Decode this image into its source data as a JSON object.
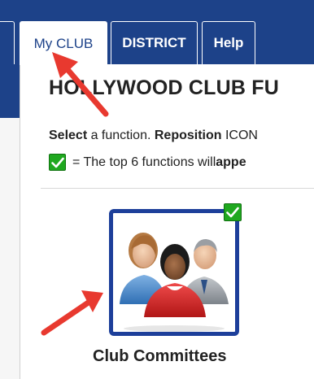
{
  "tabs": [
    {
      "label": "My CLUB",
      "active": true
    },
    {
      "label": "DISTRICT",
      "active": false
    },
    {
      "label": "Help",
      "active": false
    }
  ],
  "page": {
    "title": "HOLLYWOOD CLUB FU"
  },
  "instructions": {
    "line1_bold1": "Select",
    "line1_text1": " a function. ",
    "line1_bold2": "Reposition",
    "line1_text2": " ICON",
    "line2_text": "= The top 6 functions will ",
    "line2_bold": "appe"
  },
  "tile": {
    "label": "Club Committees",
    "checked": true,
    "icon": "people-group-icon"
  },
  "colors": {
    "brand_blue": "#1d4289",
    "tile_border": "#1d3f9a",
    "check_green": "#1fa81f",
    "arrow_red": "#e8392f"
  }
}
